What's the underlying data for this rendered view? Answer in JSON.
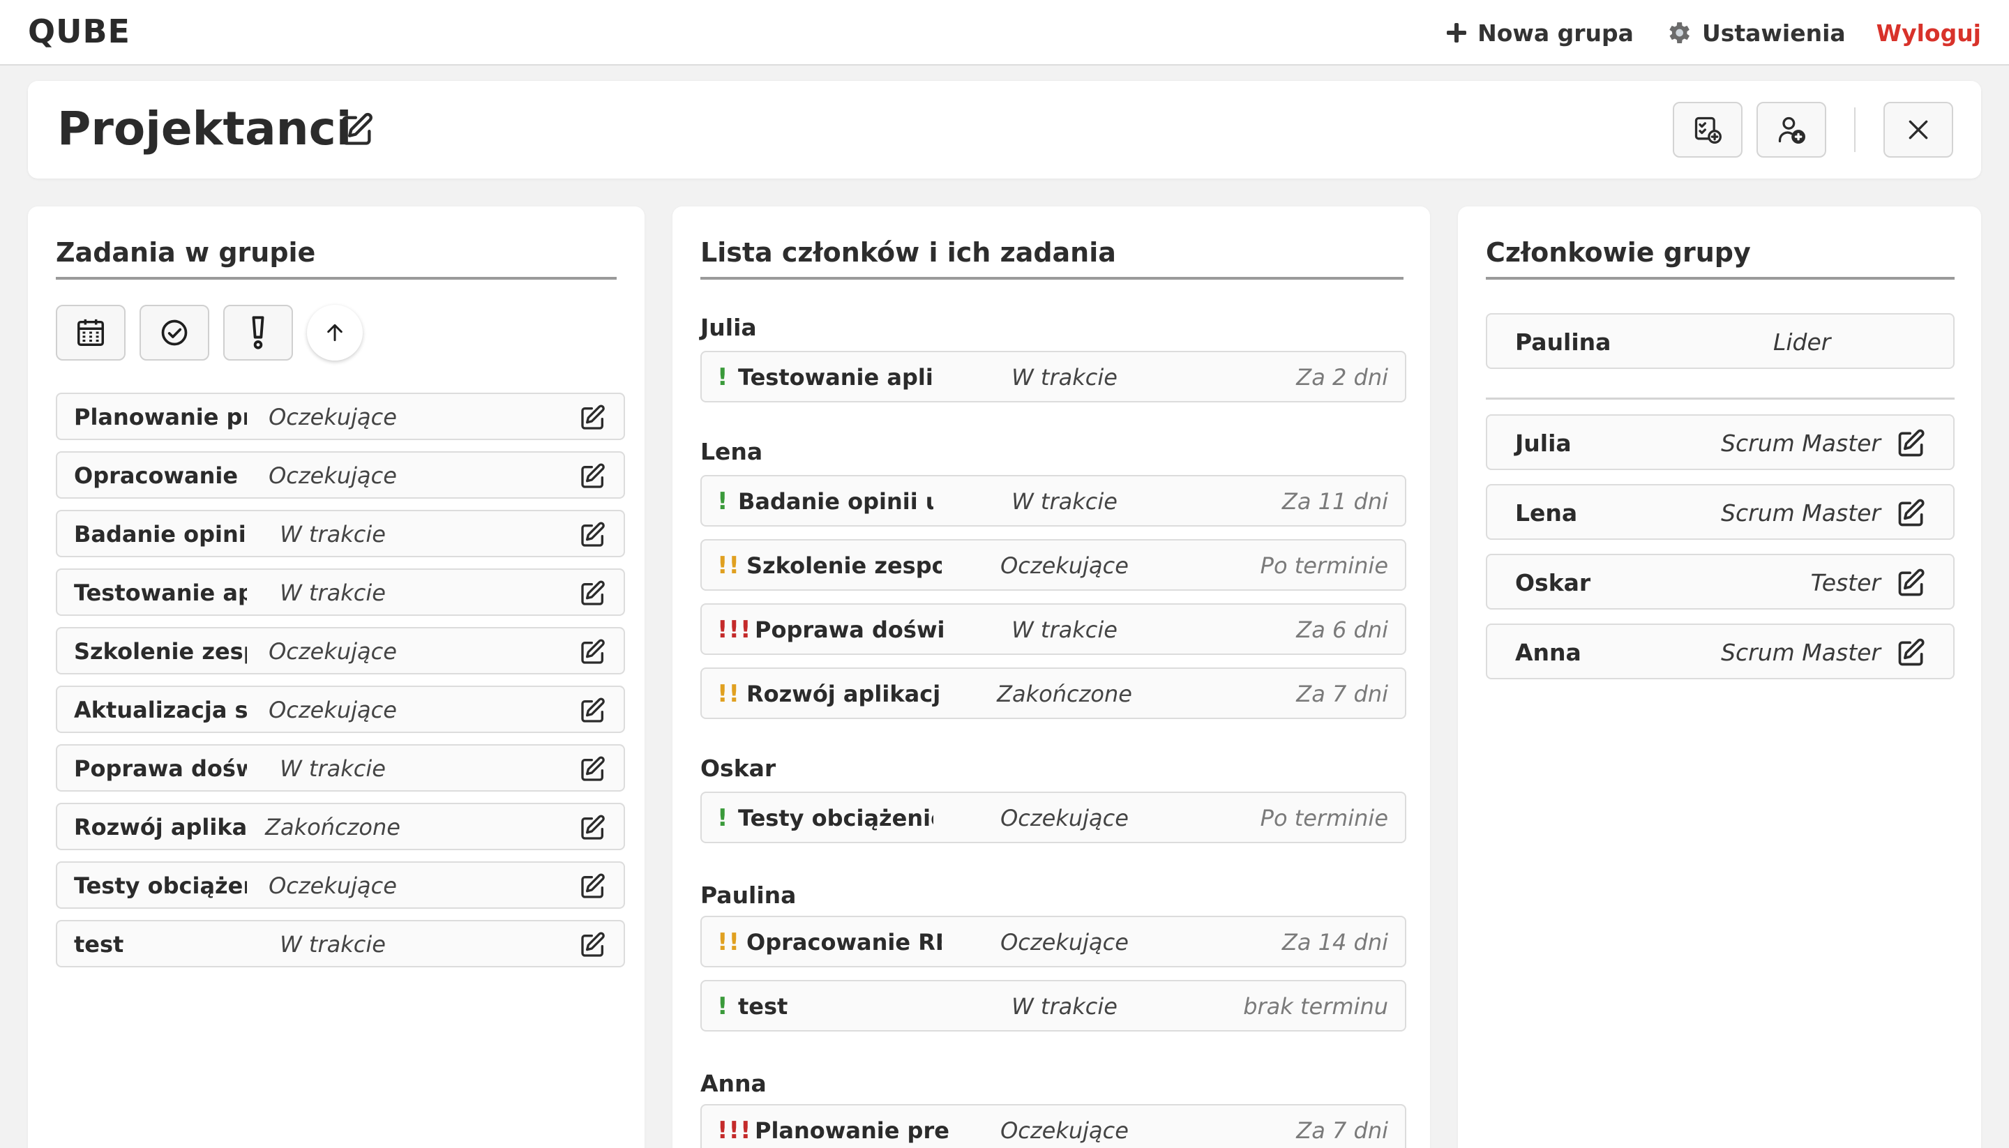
{
  "app": {
    "logo": "QUBE",
    "nav": {
      "new_group": "Nowa grupa",
      "settings": "Ustawienia",
      "logout": "Wyloguj"
    }
  },
  "group": {
    "title": "Projektanci"
  },
  "tasks_panel": {
    "title": "Zadania w grupie",
    "tasks": [
      {
        "name": "Planowanie pr",
        "status": "Oczekujące"
      },
      {
        "name": "Opracowanie R",
        "status": "Oczekujące"
      },
      {
        "name": "Badanie opinii",
        "status": "W trakcie"
      },
      {
        "name": "Testowanie apl",
        "status": "W trakcie"
      },
      {
        "name": "Szkolenie zesp",
        "status": "Oczekujące"
      },
      {
        "name": "Aktualizacja sy",
        "status": "Oczekujące"
      },
      {
        "name": "Poprawa dośw",
        "status": "W trakcie"
      },
      {
        "name": "Rozwój aplikac",
        "status": "Zakończone"
      },
      {
        "name": "Testy obciążen",
        "status": "Oczekujące"
      },
      {
        "name": "test",
        "status": "W trakcie"
      }
    ]
  },
  "members_tasks_panel": {
    "title": "Lista członków i ich zadania",
    "members": [
      {
        "name": "Julia",
        "tasks": [
          {
            "priority": "!",
            "name": "Testowanie aplik",
            "status": "W trakcie",
            "due": "Za 2 dni"
          }
        ]
      },
      {
        "name": "Lena",
        "tasks": [
          {
            "priority": "!",
            "name": "Badanie opinii uż",
            "status": "W trakcie",
            "due": "Za 11 dni"
          },
          {
            "priority": "!!",
            "name": "Szkolenie zespoł",
            "status": "Oczekujące",
            "due": "Po terminie"
          },
          {
            "priority": "!!!",
            "name": "Poprawa doświ",
            "status": "W trakcie",
            "due": "Za 6 dni"
          },
          {
            "priority": "!!",
            "name": "Rozwój aplikacji",
            "status": "Zakończone",
            "due": "Za 7 dni"
          }
        ]
      },
      {
        "name": "Oskar",
        "tasks": [
          {
            "priority": "!",
            "name": "Testy obciążeniow",
            "status": "Oczekujące",
            "due": "Po terminie"
          }
        ]
      },
      {
        "name": "Paulina",
        "tasks": [
          {
            "priority": "!!",
            "name": "Opracowanie RE",
            "status": "Oczekujące",
            "due": "Za 14 dni"
          },
          {
            "priority": "!",
            "name": "test",
            "status": "W trakcie",
            "due": "brak terminu"
          }
        ]
      },
      {
        "name": "Anna",
        "tasks": [
          {
            "priority": "!!!",
            "name": "Planowanie pre",
            "status": "Oczekujące",
            "due": "Za 7 dni"
          }
        ]
      }
    ]
  },
  "group_members_panel": {
    "title": "Członkowie grupy",
    "leader": {
      "name": "Paulina",
      "role": "Lider"
    },
    "members": [
      {
        "name": "Julia",
        "role": "Scrum Master"
      },
      {
        "name": "Lena",
        "role": "Scrum Master"
      },
      {
        "name": "Oskar",
        "role": "Tester"
      },
      {
        "name": "Anna",
        "role": "Scrum Master"
      }
    ]
  },
  "icons": {
    "new_group": "plus-icon",
    "settings": "gear-icon",
    "edit": "edit-icon",
    "add_task": "add-task-icon",
    "add_member": "add-member-icon",
    "close": "close-icon",
    "filter_date": "calendar-icon",
    "filter_status": "check-circle-icon",
    "filter_priority": "exclamation-icon",
    "sort": "arrow-up-icon"
  },
  "colors": {
    "logout": "#d8322a",
    "priority_low": "#3a9a3a",
    "priority_medium": "#e0a020",
    "priority_high": "#c42a2a"
  }
}
